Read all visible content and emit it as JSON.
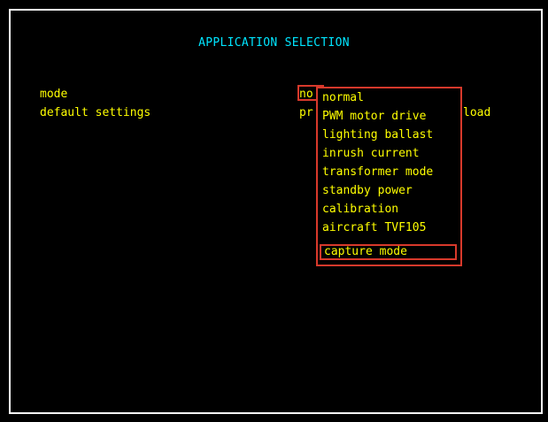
{
  "screen": {
    "title": "APPLICATION SELECTION"
  },
  "rows": [
    {
      "label": "mode",
      "value": "no"
    },
    {
      "label": "default settings",
      "value": "pr",
      "value_right": "load"
    }
  ],
  "dropdown": {
    "options": [
      "normal",
      "PWM motor drive",
      "lighting ballast",
      "inrush current",
      "transformer mode",
      "standby power",
      "calibration",
      "aircraft TVF105",
      "capture mode"
    ],
    "highlighted": "capture mode"
  },
  "colors": {
    "title": "#00e5ff",
    "text": "#ffff00",
    "highlight_border": "#d8392b",
    "frame": "#ffffff",
    "background": "#000000"
  }
}
